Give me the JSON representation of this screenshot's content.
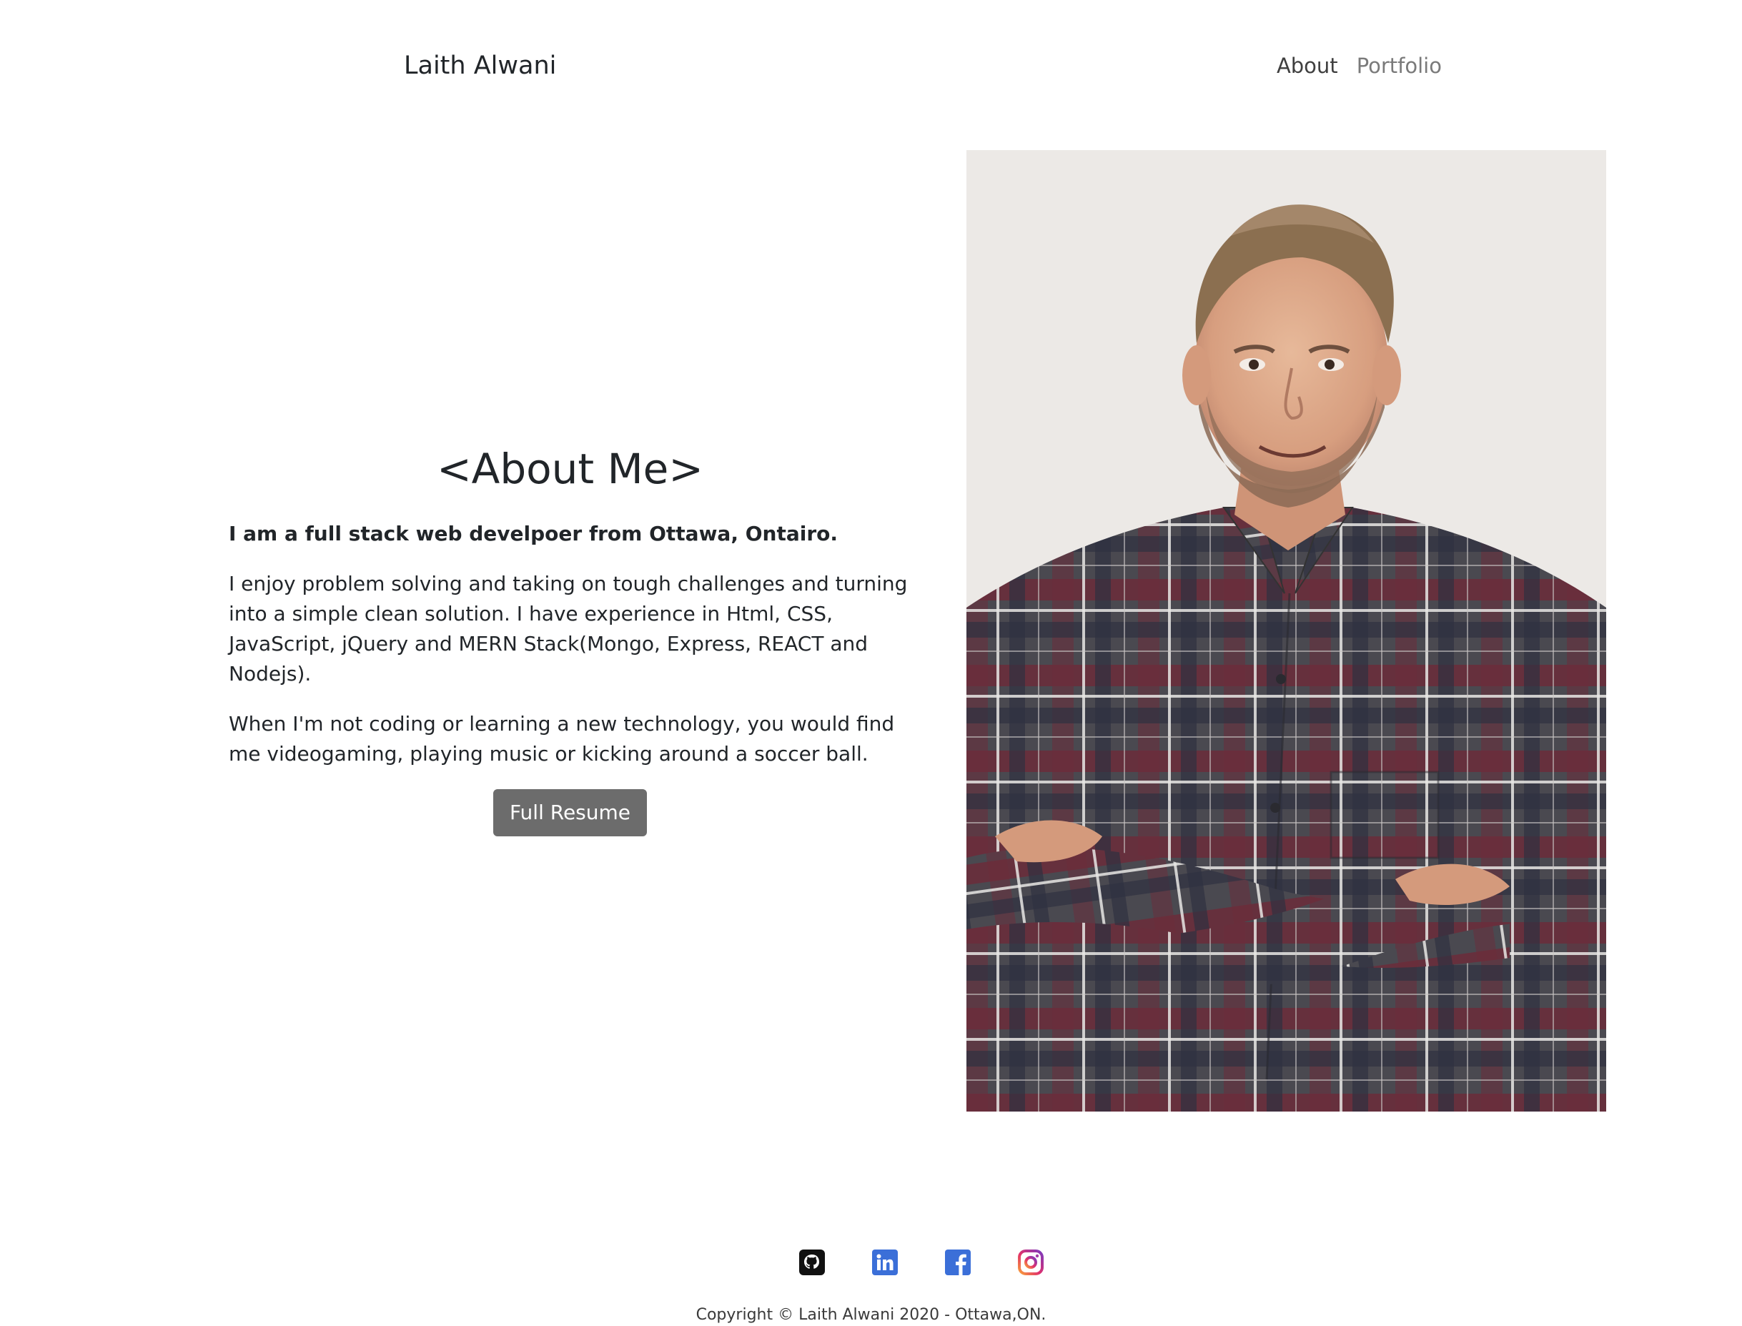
{
  "navbar": {
    "brand": "Laith Alwani",
    "links": [
      {
        "label": "About"
      },
      {
        "label": "Portfolio"
      }
    ]
  },
  "about": {
    "title": "<About Me>",
    "lead": "I am a full stack web develpoer from Ottawa, Ontairo.",
    "paragraphs": [
      "I enjoy problem solving and taking on tough challenges and turning into a simple clean solution. I have experience in Html, CSS, JavaScript, jQuery and MERN Stack(Mongo, Express, REACT and Nodejs).",
      "When I'm not coding or learning a new technology, you would find me videogaming, playing music or kicking around a soccer ball."
    ],
    "button_label": "Full Resume"
  },
  "photo": {
    "shirt_colors": [
      "#4a4950",
      "#7a2f3d",
      "#e8e6e4",
      "#2f3140"
    ],
    "background": "#ece9e6"
  },
  "footer": {
    "socials": [
      {
        "icon": "github-icon",
        "color": "#111111"
      },
      {
        "icon": "linkedin-icon",
        "color": "#3b6fd8"
      },
      {
        "icon": "facebook-icon",
        "color": "#3b6fd8"
      },
      {
        "icon": "instagram-icon",
        "color": "#c13584"
      }
    ],
    "copyright": "Copyright © Laith Alwani 2020 - Ottawa,ON."
  }
}
